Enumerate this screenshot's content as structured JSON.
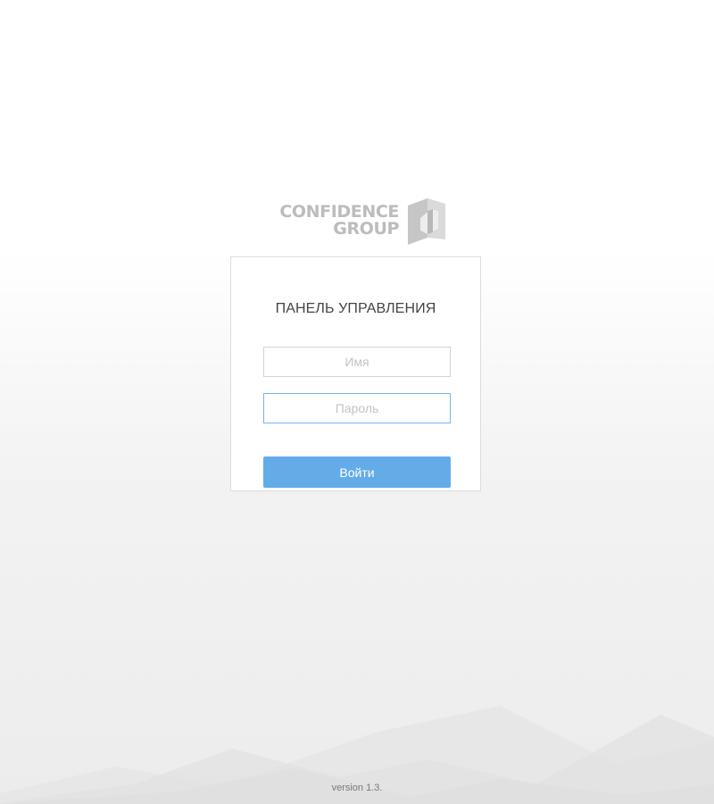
{
  "brand": {
    "line1": "CONFIDENCE",
    "line2": "GROUP"
  },
  "login": {
    "title": "ПАНЕЛЬ УПРАВЛЕНИЯ",
    "username_placeholder": "Имя",
    "username_value": "",
    "password_placeholder": "Пароль",
    "password_value": "",
    "submit_label": "Войти"
  },
  "footer": {
    "version": "version 1.3."
  },
  "colors": {
    "accent": "#64ace8",
    "focus_border": "#78b4e6",
    "logo_gray": "#bcbcbc"
  },
  "icons": {
    "logo_mark": "confidence-group-logo-mark"
  }
}
